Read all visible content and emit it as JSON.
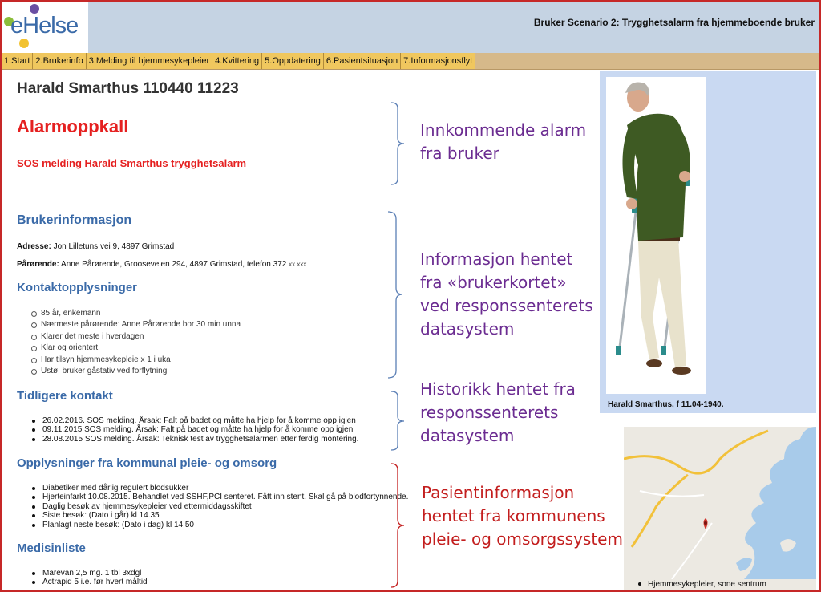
{
  "header": {
    "logo_text": "eHelse",
    "scenario_title": "Bruker Scenario 2: Trygghetsalarm fra hjemmeboende bruker"
  },
  "tabs": [
    {
      "label": "1.Start"
    },
    {
      "label": "2.Brukerinfo"
    },
    {
      "label": "3.Melding til hjemmesykepleier"
    },
    {
      "label": "4.Kvittering"
    },
    {
      "label": "5.Oppdatering"
    },
    {
      "label": "6.Pasientsituasjon"
    },
    {
      "label": "7.Informasjonsflyt"
    }
  ],
  "patient": {
    "title": "Harald Smarthus 110440 11223"
  },
  "alarm": {
    "heading": "Alarmoppkall",
    "sos_text": "SOS melding Harald Smarthus trygghetsalarm"
  },
  "brukerinfo": {
    "heading": "Brukerinformasjon",
    "adresse_label": "Adresse:",
    "adresse_value": "Jon Lilletuns vei 9, 4897 Grimstad",
    "parorende_label": "Pårørende:",
    "parorende_value": "Anne Pårørende, Grooseveien 294, 4897 Grimstad, telefon 372",
    "parorende_suffix": "xx xxx"
  },
  "kontakt": {
    "heading": "Kontaktopplysninger",
    "items": [
      "85 år, enkemann",
      "Nærmeste pårørende: Anne Pårørende bor 30 min unna",
      "Klarer det meste i hverdagen",
      "Klar og orientert",
      "Har tilsyn hjemmesykepleie x 1 i uka",
      "Ustø, bruker gåstativ ved forflytning"
    ]
  },
  "tidligere": {
    "heading": "Tidligere kontakt",
    "items": [
      "26.02.2016. SOS melding. Årsak: Falt på badet og måtte ha hjelp for å komme opp igjen",
      "09.11.2015  SOS melding. Årsak: Falt på badet og måtte ha hjelp for å komme opp igjen",
      "28.08.2015  SOS melding. Årsak: Teknisk test av trygghetsalarmen etter ferdig montering."
    ]
  },
  "kommunal": {
    "heading": "Opplysninger fra kommunal pleie- og omsorg",
    "items": [
      "Diabetiker med dårlig regulert blodsukker",
      "Hjerteinfarkt 10.08.2015. Behandlet ved SSHF,PCI senteret. Fått inn stent. Skal gå på blodfortynnende.",
      "Daglig besøk av hjemmesykepleier ved ettermiddagsskiftet",
      "Siste besøk: (Dato i går) kl 14.35",
      "Planlagt neste besøk: (Dato i dag) kl 14.50"
    ]
  },
  "medisin": {
    "heading": "Medisinliste",
    "items": [
      "Marevan 2,5 mg. 1 tbl 3xdgl",
      "Actrapid 5 i.e. før hvert måltid"
    ]
  },
  "annotations": {
    "a1_line1": "Innkommende alarm",
    "a1_line2": "fra bruker",
    "a2_line1": "Informasjon hentet",
    "a2_line2": "fra «brukerkortet»",
    "a2_line3": "ved responssenterets",
    "a2_line4": "datasystem",
    "a3_line1": "Historikk hentet fra",
    "a3_line2": "responssenterets",
    "a3_line3": "datasystem",
    "a4_line1": "Pasientinformasjon",
    "a4_line2": "hentet fra kommunens",
    "a4_line3": "pleie- og omsorgssystem"
  },
  "photo": {
    "caption": "Harald Smarthus, f 11.04-1940."
  },
  "map": {
    "caption": "Hjemmesykepleier, sone sentrum"
  },
  "colors": {
    "header_bg": "#c5d3e3",
    "tab_bg": "#f0c75e",
    "heading_blue": "#3a6aa8",
    "alarm_red": "#e52020",
    "annotation_purple": "#6b2c91",
    "annotation_red": "#c31e1e",
    "frame_red": "#c62828"
  }
}
